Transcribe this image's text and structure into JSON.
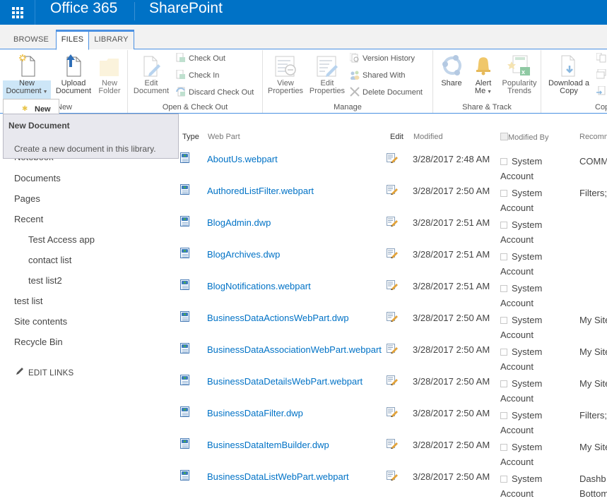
{
  "suitebar": {
    "brand": "Office 365",
    "app": "SharePoint",
    "color": "#0072c6"
  },
  "ribbon_tabs": [
    {
      "label": "BROWSE",
      "active": false
    },
    {
      "label": "FILES",
      "active": true
    },
    {
      "label": "LIBRARY",
      "active": false
    }
  ],
  "ribbon": {
    "groups": {
      "new": {
        "label": "New",
        "new_document": {
          "line1": "New",
          "line2": "Document",
          "icon": "new-document-icon"
        },
        "upload_document": {
          "line1": "Upload",
          "line2": "Document",
          "icon": "upload-icon"
        },
        "new_folder": {
          "line1": "New",
          "line2": "Folder",
          "icon": "folder-icon"
        }
      },
      "open_checkout": {
        "label": "Open & Check Out",
        "edit_document": {
          "line1": "Edit",
          "line2": "Document",
          "icon": "edit-document-icon"
        },
        "check_out": "Check Out",
        "check_in": "Check In",
        "discard_check_out": "Discard Check Out"
      },
      "manage": {
        "label": "Manage",
        "view_properties": {
          "line1": "View",
          "line2": "Properties",
          "icon": "view-properties-icon"
        },
        "edit_properties": {
          "line1": "Edit",
          "line2": "Properties",
          "icon": "edit-properties-icon"
        },
        "version_history": "Version History",
        "shared_with": "Shared With",
        "delete_document": "Delete Document"
      },
      "share_track": {
        "label": "Share & Track",
        "share": "Share",
        "alert_me": {
          "line1": "Alert",
          "line2": "Me"
        },
        "popularity_trends": {
          "line1": "Popularity",
          "line2": "Trends"
        }
      },
      "copies": {
        "label": "Cop",
        "download_copy": {
          "line1": "Download a",
          "line2": "Copy"
        }
      }
    }
  },
  "new_dropdown": {
    "item_label": "New"
  },
  "tooltip": {
    "title": "New Document",
    "body": "Create a new document in this library."
  },
  "leftnav": {
    "items": [
      {
        "label": "Notebook",
        "sub": false
      },
      {
        "label": "Documents",
        "sub": false
      },
      {
        "label": "Pages",
        "sub": false
      },
      {
        "label": "Recent",
        "sub": false
      },
      {
        "label": "Test Access app",
        "sub": true
      },
      {
        "label": "contact list",
        "sub": true
      },
      {
        "label": "test list2",
        "sub": true
      },
      {
        "label": "test list",
        "sub": false
      },
      {
        "label": "Site contents",
        "sub": false
      },
      {
        "label": "Recycle Bin",
        "sub": false
      }
    ],
    "edit_links": "EDIT LINKS"
  },
  "table": {
    "columns": {
      "type": "Type",
      "name": "Web Part",
      "edit": "Edit",
      "modified": "Modified",
      "modified_by": "Modified By",
      "recommendation": "Recomm"
    },
    "rows": [
      {
        "name": "AboutUs.webpart",
        "modified": "3/28/2017 2:48 AM",
        "modified_by_1": "System",
        "modified_by_2": "Account",
        "recomm_1": "COMM",
        "recomm_2": ""
      },
      {
        "name": "AuthoredListFilter.webpart",
        "modified": "3/28/2017 2:50 AM",
        "modified_by_1": "System",
        "modified_by_2": "Account",
        "recomm_1": "Filters;",
        "recomm_2": ""
      },
      {
        "name": "BlogAdmin.dwp",
        "modified": "3/28/2017 2:51 AM",
        "modified_by_1": "System",
        "modified_by_2": "Account",
        "recomm_1": "",
        "recomm_2": ""
      },
      {
        "name": "BlogArchives.dwp",
        "modified": "3/28/2017 2:51 AM",
        "modified_by_1": "System",
        "modified_by_2": "Account",
        "recomm_1": "",
        "recomm_2": ""
      },
      {
        "name": "BlogNotifications.webpart",
        "modified": "3/28/2017 2:51 AM",
        "modified_by_1": "System",
        "modified_by_2": "Account",
        "recomm_1": "",
        "recomm_2": ""
      },
      {
        "name": "BusinessDataActionsWebPart.dwp",
        "modified": "3/28/2017 2:50 AM",
        "modified_by_1": "System",
        "modified_by_2": "Account",
        "recomm_1": "My Site",
        "recomm_2": ""
      },
      {
        "name": "BusinessDataAssociationWebPart.webpart",
        "modified": "3/28/2017 2:50 AM",
        "modified_by_1": "System",
        "modified_by_2": "Account",
        "recomm_1": "My Site",
        "recomm_2": ""
      },
      {
        "name": "BusinessDataDetailsWebPart.webpart",
        "modified": "3/28/2017 2:50 AM",
        "modified_by_1": "System",
        "modified_by_2": "Account",
        "recomm_1": "My Site",
        "recomm_2": ""
      },
      {
        "name": "BusinessDataFilter.dwp",
        "modified": "3/28/2017 2:50 AM",
        "modified_by_1": "System",
        "modified_by_2": "Account",
        "recomm_1": "Filters;",
        "recomm_2": ""
      },
      {
        "name": "BusinessDataItemBuilder.dwp",
        "modified": "3/28/2017 2:50 AM",
        "modified_by_1": "System",
        "modified_by_2": "Account",
        "recomm_1": "My Site",
        "recomm_2": ""
      },
      {
        "name": "BusinessDataListWebPart.webpart",
        "modified": "3/28/2017 2:50 AM",
        "modified_by_1": "System",
        "modified_by_2": "Account",
        "recomm_1": "Dashb",
        "recomm_2": "Bottom"
      }
    ]
  }
}
